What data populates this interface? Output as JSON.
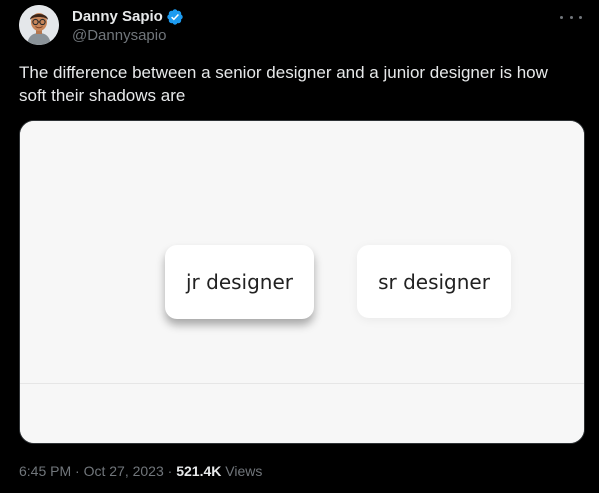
{
  "author": {
    "display_name": "Danny Sapio",
    "handle": "@Dannysapio",
    "verified_color": "#1d9bf0"
  },
  "tweet": {
    "text": "The difference between a senior designer and a junior designer is how soft their shadows are"
  },
  "media": {
    "jr_card_label": "jr designer",
    "sr_card_label": "sr designer"
  },
  "meta": {
    "time": "6:45 PM",
    "separator_1": " · ",
    "date": "Oct 27, 2023",
    "separator_2": " · ",
    "views_count": "521.4K",
    "views_label": " Views"
  },
  "icons": {
    "more": "more-icon",
    "verified": "verified-badge-icon"
  }
}
